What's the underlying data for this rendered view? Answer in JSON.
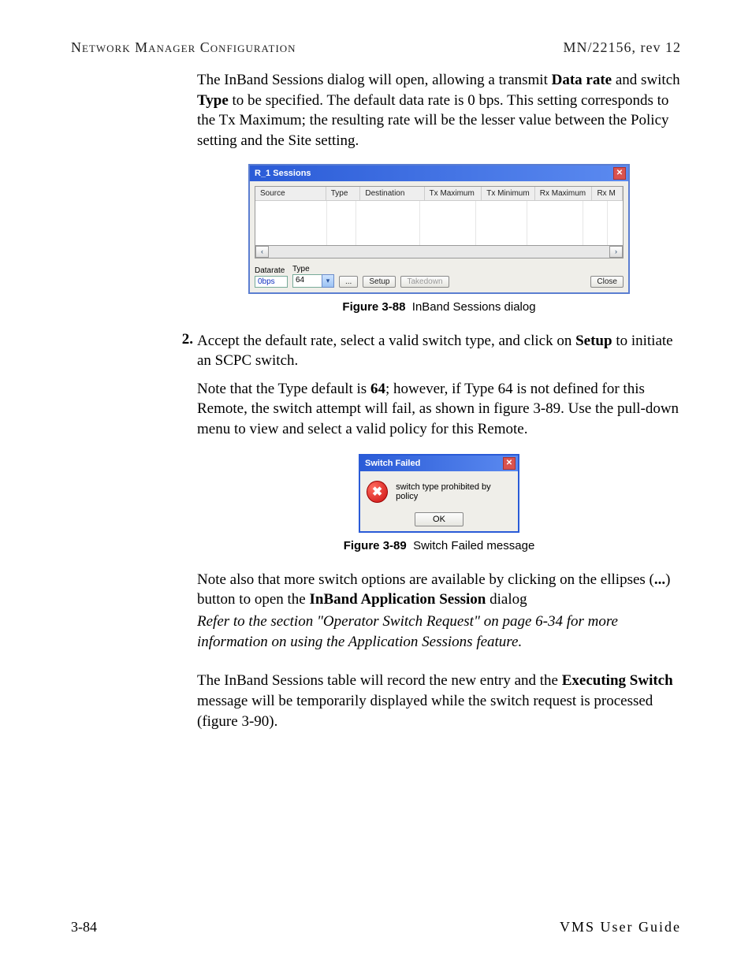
{
  "header": {
    "left": "Network Manager Configuration",
    "right": "MN/22156, rev 12"
  },
  "intro": {
    "p1a": "The InBand Sessions dialog will open, allowing a transmit ",
    "p1b": "Data rate",
    "p1c": " and switch ",
    "p1d": "Type",
    "p1e": " to be specified. The default data rate is 0 bps. This setting corresponds to the Tx Maximum; the resulting rate will be the lesser value between the Policy setting and the Site setting."
  },
  "dialog1": {
    "title": "R_1 Sessions",
    "columns": {
      "source": "Source",
      "type": "Type",
      "destination": "Destination",
      "txmax": "Tx Maximum",
      "txmin": "Tx Minimum",
      "rxmax": "Rx Maximum",
      "rxm": "Rx M"
    },
    "labels": {
      "datarate": "Datarate",
      "type": "Type"
    },
    "values": {
      "datarate": "0bps",
      "type": "64"
    },
    "buttons": {
      "ellipsis": "...",
      "setup": "Setup",
      "takedown": "Takedown",
      "close": "Close"
    },
    "scroll": {
      "left": "‹",
      "right": "›"
    }
  },
  "captions": {
    "fig88num": "Figure 3-88",
    "fig88txt": "InBand Sessions dialog",
    "fig89num": "Figure 3-89",
    "fig89txt": "Switch Failed message"
  },
  "step2": {
    "num": "2.",
    "a": "Accept the default rate, select a valid switch type, and click on ",
    "b": "Setup",
    "c": " to initiate an SCPC switch."
  },
  "note1": {
    "a": "Note that the Type default is ",
    "b": "64",
    "c": "; however, if Type 64 is not defined for this Remote, the switch attempt will fail, as shown in figure 3-89. Use the pull-down menu to view and select a valid policy for this Remote."
  },
  "dialog2": {
    "title": "Switch Failed",
    "message": "switch type prohibited by policy",
    "ok": "OK",
    "iconglyph": "✖"
  },
  "note2": {
    "a": "Note also that more switch options are available by clicking on the ellipses (",
    "b": "...",
    "c": ") button to open the ",
    "d": "InBand Application Session",
    "e": " dialog"
  },
  "refer": {
    "text": "Refer to the section \"Operator Switch Request\" on page 6-34 for more information on using the Application Sessions feature"
  },
  "note3": {
    "a": "The InBand Sessions table will record the new entry and the ",
    "b": "Executing Switch",
    "c": " message will be temporarily displayed while the switch request is processed (figure 3-90)."
  },
  "footer": {
    "left": "3-84",
    "right": "VMS User Guide"
  }
}
